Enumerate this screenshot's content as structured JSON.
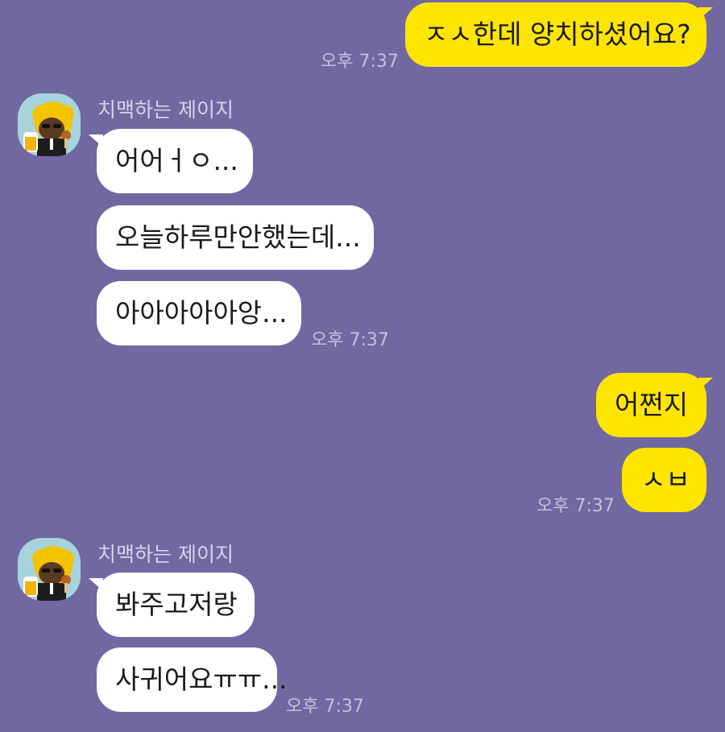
{
  "colors": {
    "background": "#7168a2",
    "my_bubble": "#fee500",
    "their_bubble": "#ffffff",
    "avatar_bg": "#a7d3dc"
  },
  "messages": [
    {
      "side": "me",
      "text": "ㅈㅅ한데 양치하셨어요?",
      "time": "오후 7:37"
    },
    {
      "side": "them",
      "sender": "치맥하는 제이지",
      "avatar_icon": "jay-g-beer-avatar-icon",
      "bubbles": [
        "어어ㅓㅇ...",
        "오늘하루만안했는데...",
        "아아아아아앙..."
      ],
      "time": "오후 7:37"
    },
    {
      "side": "me",
      "bubbles": [
        "어쩐지",
        "ㅅㅂ"
      ],
      "time": "오후 7:37"
    },
    {
      "side": "them",
      "sender": "치맥하는 제이지",
      "avatar_icon": "jay-g-beer-avatar-icon",
      "bubbles": [
        "봐주고저랑",
        "사귀어요ㅠㅠ..."
      ],
      "time": "오후 7:37"
    }
  ]
}
